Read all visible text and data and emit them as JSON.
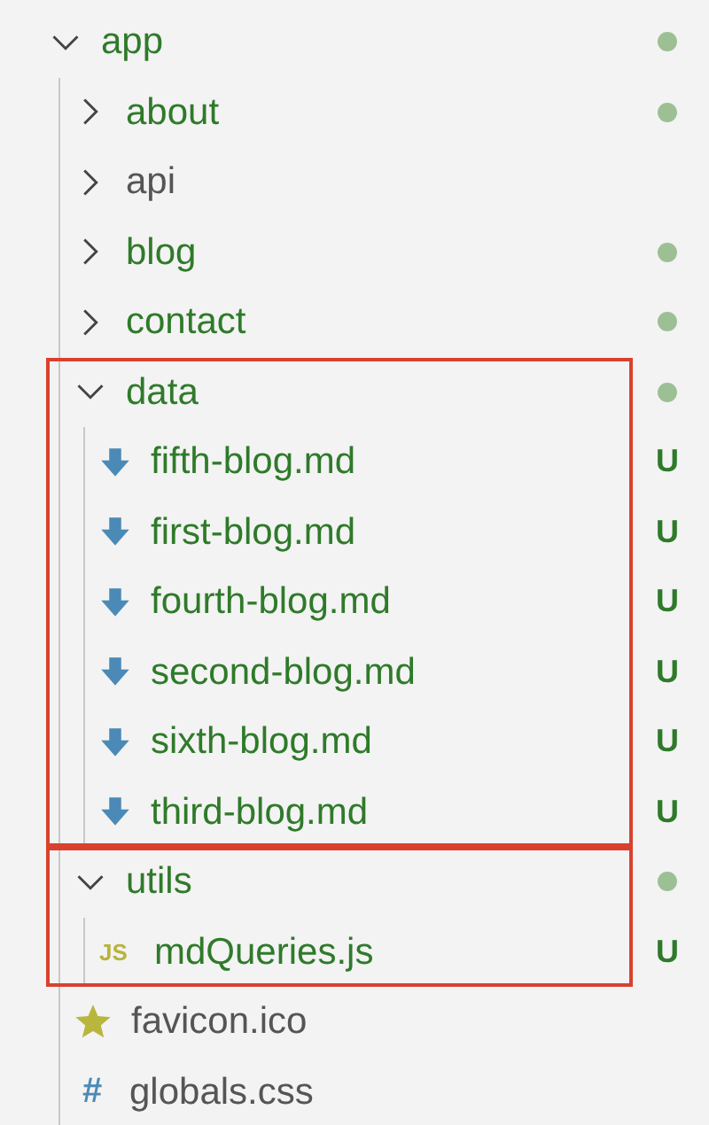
{
  "tree": [
    {
      "name": "app",
      "kind": "folder",
      "expanded": true,
      "untracked": true,
      "dot": true,
      "highlighted": false,
      "children": [
        {
          "name": "about",
          "kind": "folder",
          "expanded": false,
          "untracked": true,
          "dot": true,
          "highlighted": false
        },
        {
          "name": "api",
          "kind": "folder",
          "expanded": false,
          "untracked": false,
          "dot": false,
          "highlighted": false
        },
        {
          "name": "blog",
          "kind": "folder",
          "expanded": false,
          "untracked": true,
          "dot": true,
          "highlighted": false
        },
        {
          "name": "contact",
          "kind": "folder",
          "expanded": false,
          "untracked": true,
          "dot": true,
          "highlighted": false
        },
        {
          "name": "data",
          "kind": "folder",
          "expanded": true,
          "untracked": true,
          "dot": true,
          "highlighted": true,
          "children": [
            {
              "name": "fifth-blog.md",
              "kind": "markdown",
              "untracked": true,
              "badge": "U"
            },
            {
              "name": "first-blog.md",
              "kind": "markdown",
              "untracked": true,
              "badge": "U"
            },
            {
              "name": "fourth-blog.md",
              "kind": "markdown",
              "untracked": true,
              "badge": "U"
            },
            {
              "name": "second-blog.md",
              "kind": "markdown",
              "untracked": true,
              "badge": "U"
            },
            {
              "name": "sixth-blog.md",
              "kind": "markdown",
              "untracked": true,
              "badge": "U"
            },
            {
              "name": "third-blog.md",
              "kind": "markdown",
              "untracked": true,
              "badge": "U"
            }
          ]
        },
        {
          "name": "utils",
          "kind": "folder",
          "expanded": true,
          "untracked": true,
          "dot": true,
          "highlighted": true,
          "children": [
            {
              "name": "mdQueries.js",
              "kind": "javascript",
              "icon_text": "JS",
              "untracked": true,
              "badge": "U"
            }
          ]
        },
        {
          "name": "favicon.ico",
          "kind": "favicon",
          "untracked": false
        },
        {
          "name": "globals.css",
          "kind": "css",
          "icon_text": "#",
          "untracked": false
        }
      ]
    }
  ]
}
